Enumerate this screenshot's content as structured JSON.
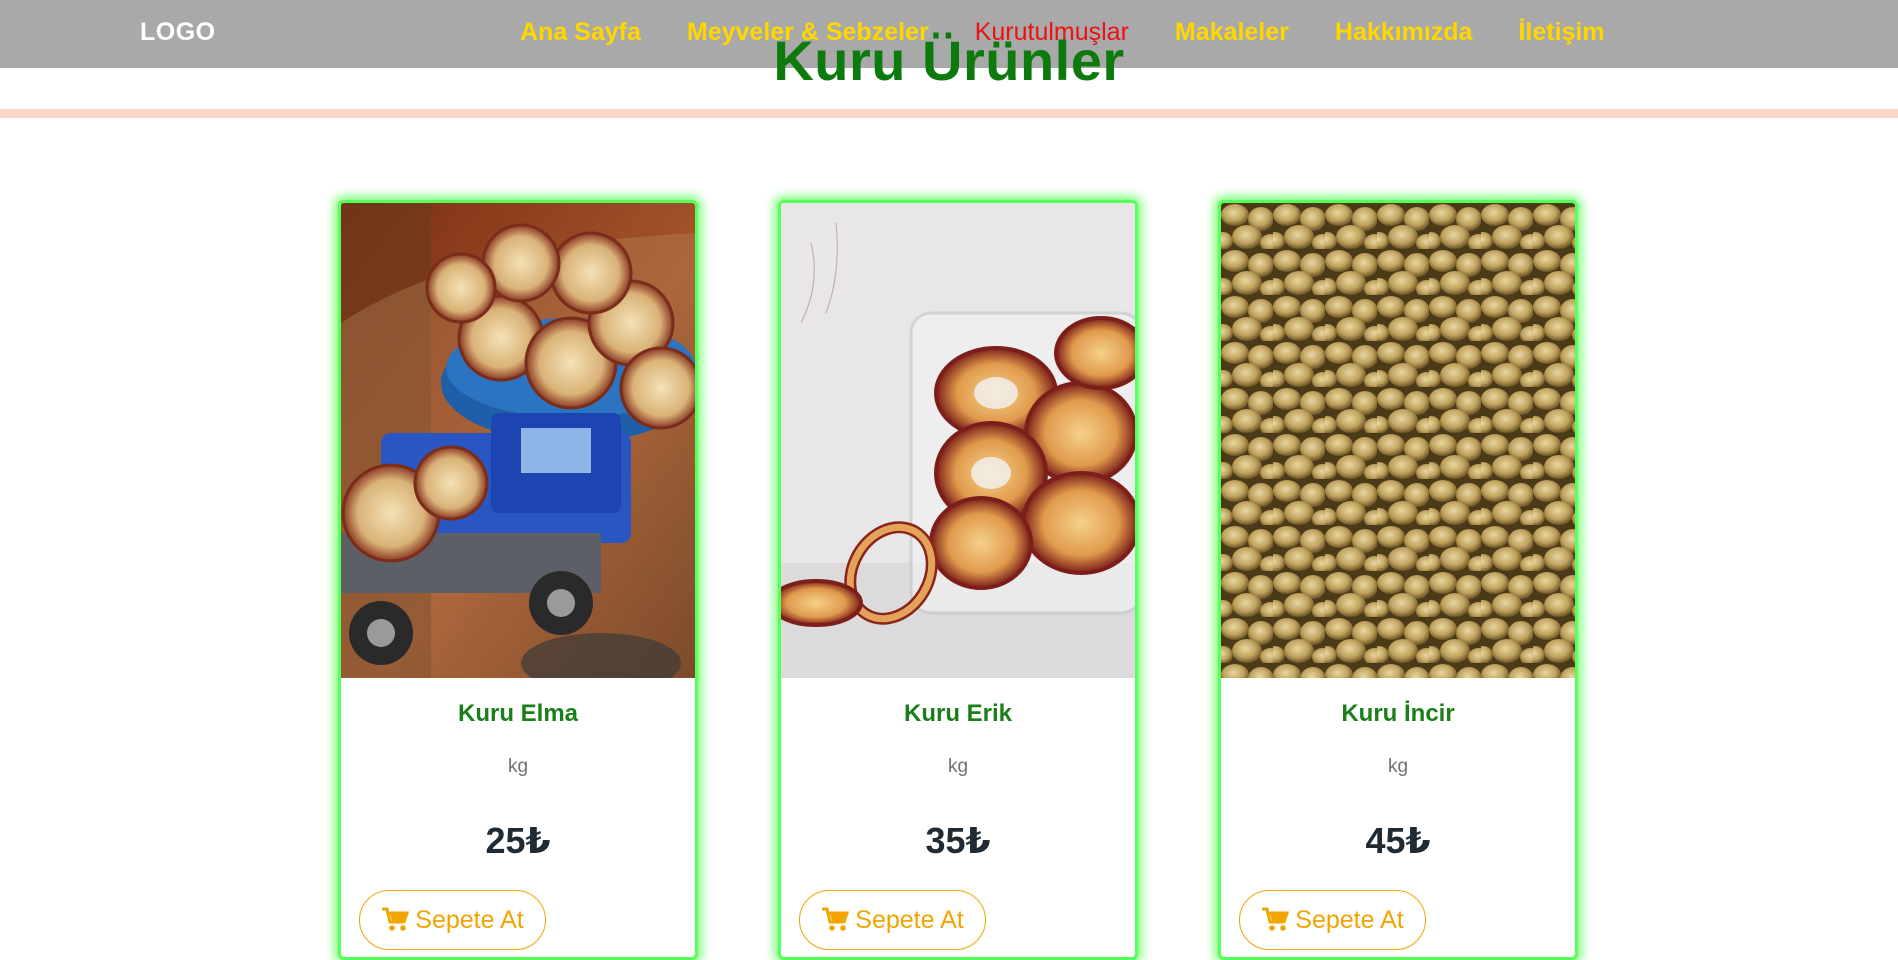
{
  "header": {
    "logo": "LOGO",
    "nav": [
      {
        "label": "Ana Sayfa",
        "active": false
      },
      {
        "label": "Meyveler & Sebzeler",
        "active": false
      },
      {
        "label": "Kurutulmuşlar",
        "active": true
      },
      {
        "label": "Makaleler",
        "active": false
      },
      {
        "label": "Hakkımızda",
        "active": false
      },
      {
        "label": "İletişim",
        "active": false
      }
    ]
  },
  "page": {
    "title": "Kuru Ürünler"
  },
  "products": [
    {
      "name": "Kuru Elma",
      "unit": "kg",
      "price": "25₺",
      "button": "Sepete At"
    },
    {
      "name": "Kuru Erik",
      "unit": "kg",
      "price": "35₺",
      "button": "Sepete At"
    },
    {
      "name": "Kuru İncir",
      "unit": "kg",
      "price": "45₺",
      "button": "Sepete At"
    }
  ],
  "colors": {
    "nav_bg": "#a9a9a9",
    "nav_link": "#ffd700",
    "nav_active": "#ee1111",
    "title": "#0d7a0d",
    "card_glow": "#58ff58",
    "button_accent": "#f0a500"
  },
  "icons": {
    "cart": "shopping-cart-icon"
  }
}
